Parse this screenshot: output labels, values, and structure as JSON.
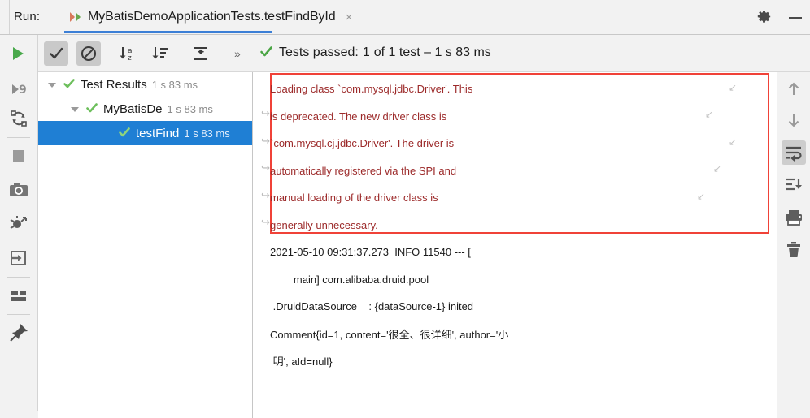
{
  "window": {
    "run_label": "Run:",
    "gear_icon": "gear-icon",
    "minimize_icon": "minimize-icon"
  },
  "tab": {
    "title": "MyBatisDemoApplicationTests.testFindById",
    "close_glyph": "×",
    "run_config_icon": "run-configuration-icon"
  },
  "toolbar": {
    "rerun_icon": "rerun-play-icon",
    "buttons": [
      {
        "name": "show-passed-toggle",
        "icon": "checkmark-icon",
        "pressed": true
      },
      {
        "name": "show-ignored-toggle",
        "icon": "no-entry-icon",
        "pressed": true
      },
      {
        "name": "sort-alphabetically",
        "icon": "sort-alphabetically-icon",
        "pressed": false
      },
      {
        "name": "sort-by-duration",
        "icon": "sort-by-duration-icon",
        "pressed": false
      },
      {
        "name": "expand-collapse",
        "icon": "expand-collapse-icon",
        "pressed": false
      }
    ],
    "overflow_label": "»",
    "status": {
      "check_icon": "green-check-icon",
      "prefix": "Tests passed:",
      "count": "1",
      "suffix": "of 1 test – 1 s 83 ms"
    }
  },
  "left_gutter": {
    "items": [
      {
        "name": "rerun-failed-tests-icon",
        "label": "rerun-failed-tests"
      },
      {
        "name": "rerun-automatically-icon",
        "label": "rerun-automatically"
      },
      {
        "name": "stop-icon",
        "label": "stop"
      },
      {
        "name": "camera-snapshot-icon",
        "label": "export-test-results"
      },
      {
        "name": "mute-breakpoints-icon",
        "label": "mute-breakpoints"
      },
      {
        "name": "jump-to-source-icon",
        "label": "jump-to-source"
      },
      {
        "name": "layout-settings-icon",
        "label": "layout-settings"
      },
      {
        "name": "pin-tab-icon",
        "label": "pin-tab"
      }
    ]
  },
  "right_gutter": {
    "items": [
      {
        "name": "up-arrow-icon",
        "label": "previous-occurrence",
        "pressed": false
      },
      {
        "name": "down-arrow-icon",
        "label": "next-occurrence",
        "pressed": false
      },
      {
        "name": "soft-wrap-icon",
        "label": "soft-wrap",
        "pressed": true
      },
      {
        "name": "scroll-to-end-icon",
        "label": "scroll-to-end",
        "pressed": false
      },
      {
        "name": "print-icon",
        "label": "print",
        "pressed": false
      },
      {
        "name": "trash-icon",
        "label": "clear-all",
        "pressed": false
      }
    ]
  },
  "test_tree": {
    "rows": [
      {
        "label": "Test Results",
        "time": "1 s 83 ms",
        "indent": 12,
        "has_arrow": true,
        "selected": false,
        "status_icon": "green-check-icon"
      },
      {
        "label": "MyBatisDe",
        "time": "1 s 83 ms",
        "indent": 40,
        "has_arrow": true,
        "selected": false,
        "status_icon": "green-check-icon"
      },
      {
        "label": "testFind",
        "time": "1 s 83 ms",
        "indent": 95,
        "has_arrow": false,
        "selected": true,
        "status_icon": "green-check-icon"
      }
    ]
  },
  "console": {
    "warning_border_color": "#f04238",
    "warning_text_color": "#9c2a2a",
    "lines": [
      {
        "text": "Loading class `com.mysql.jdbc.Driver'. This",
        "kind": "warn",
        "indent": 12,
        "wrap_start": false,
        "wrap_end": true
      },
      {
        "text": "is deprecated. The new driver class is",
        "kind": "warn",
        "indent": 22,
        "wrap_start": true,
        "wrap_end": true
      },
      {
        "text": "`com.mysql.cj.jdbc.Driver'. The driver is",
        "kind": "warn",
        "indent": 22,
        "wrap_start": true,
        "wrap_end": true
      },
      {
        "text": "automatically registered via the SPI and",
        "kind": "warn",
        "indent": 22,
        "wrap_start": true,
        "wrap_end": true
      },
      {
        "text": "manual loading of the driver class is",
        "kind": "warn",
        "indent": 22,
        "wrap_start": true,
        "wrap_end": true
      },
      {
        "text": "generally unnecessary.",
        "kind": "warn",
        "indent": 22,
        "wrap_start": true,
        "wrap_end": false
      },
      {
        "text": "2021-05-10 09:31:37.273  INFO 11540 --- [",
        "kind": "log",
        "indent": 12,
        "wrap_start": false,
        "wrap_end": false
      },
      {
        "text": "        main] com.alibaba.druid.pool",
        "kind": "log",
        "indent": 12,
        "wrap_start": false,
        "wrap_end": false
      },
      {
        "text": " .DruidDataSource    : {dataSource-1} inited",
        "kind": "log",
        "indent": 12,
        "wrap_start": false,
        "wrap_end": false
      },
      {
        "text": "Comment{id=1, content='很全、很详细', author='小",
        "kind": "log",
        "indent": 12,
        "wrap_start": false,
        "wrap_end": false
      },
      {
        "text": " 明', aId=null}",
        "kind": "log",
        "indent": 12,
        "wrap_start": false,
        "wrap_end": false
      }
    ]
  }
}
